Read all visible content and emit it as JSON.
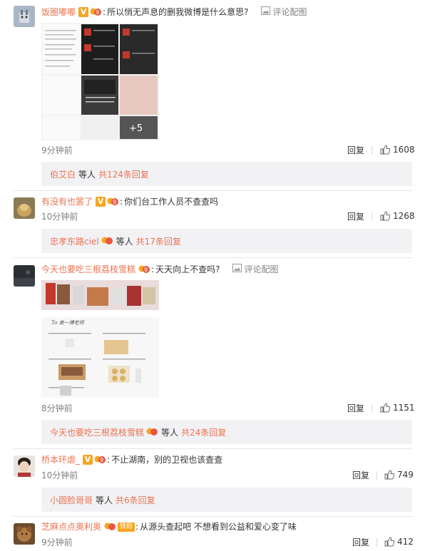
{
  "comments": [
    {
      "username": "饭圈嘟嘟",
      "text": "所以悄无声息的删我微博是什么意思?",
      "pic_label": "评论配图",
      "time": "9分钟前",
      "reply_label": "回复",
      "likes": "1608",
      "sub_name": "伯艾白",
      "sub_mid": "等人",
      "sub_count": "共124条回复",
      "thumb_texts": {
        "t1": "说，都是最喜欢最好的你，当他们说\"专门的说\"的时候，",
        "t2": "你想把我放回你那里么？",
        "t3": "+5"
      }
    },
    {
      "username": "有没有也罢了",
      "text": "你们台工作人员不查查吗",
      "time": "10分钟前",
      "reply_label": "回复",
      "likes": "1268",
      "sub_name": "忠孝东路ciel",
      "sub_mid": "等人",
      "sub_count": "共17条回复"
    },
    {
      "username": "今天也要吃三根荔枝雪糕",
      "text": "天天向上不查吗?",
      "pic_label": "评论配图",
      "time": "8分钟前",
      "reply_label": "回复",
      "likes": "1151",
      "sub_name": "今天也要吃三根荔枝雪糕",
      "sub_mid": "等人",
      "sub_count": "共24条回复",
      "thumb_texts": {
        "t1": "To 美一博老师"
      }
    },
    {
      "username": "桥本环虐_",
      "text": "不止湖南，别的卫视也该查查",
      "time": "10分钟前",
      "reply_label": "回复",
      "likes": "749",
      "sub_name": "小圆脸哥哥",
      "sub_mid": "等人",
      "sub_count": "共6条回复"
    },
    {
      "username": "芝麻点点奥利奥",
      "text": "从源头查起吧 不想看到公益和爱心变了味",
      "badge_text": "铁粉",
      "time": "9分钟前",
      "reply_label": "回复",
      "likes": "412"
    }
  ],
  "colors": {
    "username": "#eb7350",
    "body_text": "#333333",
    "meta_text": "#808080",
    "sub_bg": "#f2f2f5",
    "v_badge": "#f6a623"
  },
  "icons": [
    "vip-v-icon",
    "level-badge-icon",
    "picture-icon",
    "like-thumb-icon"
  ]
}
